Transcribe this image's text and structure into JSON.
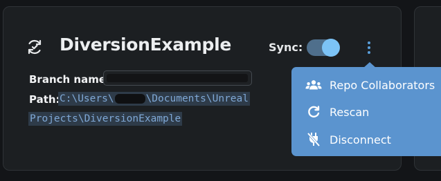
{
  "repo": {
    "name": "DiversionExample",
    "icon": "sync-arrows-icon"
  },
  "sync": {
    "label": "Sync:",
    "enabled": true
  },
  "more_menu_icon": "kebab-vertical-icon",
  "details": {
    "branch_label": "Branch name:",
    "branch_value_redacted": true,
    "path_label": "Path:",
    "path_part1": "C:\\Users\\",
    "path_part2": "\\Documents\\Unreal",
    "path_line2": "Projects\\DiversionExample"
  },
  "menu": {
    "items": [
      {
        "label": "Repo Collaborators",
        "icon": "users-icon"
      },
      {
        "label": "Rescan",
        "icon": "refresh-icon"
      },
      {
        "label": "Disconnect",
        "icon": "unplug-icon"
      }
    ]
  },
  "colors": {
    "background": "#131518",
    "card": "#1c1f22",
    "accent": "#5b94cf",
    "toggle_knob": "#7cc3f6",
    "path_text": "#7fa8d6"
  }
}
